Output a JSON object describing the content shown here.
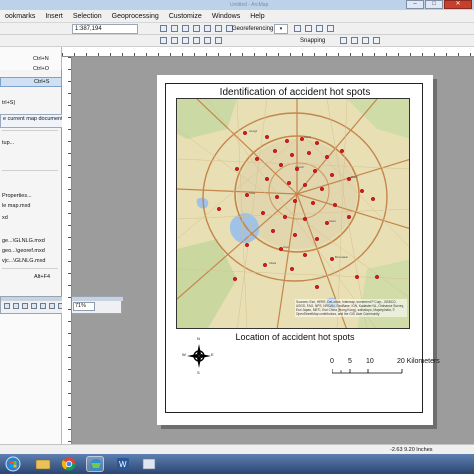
{
  "window": {
    "title": "Untitled - ArcMap"
  },
  "menubar": {
    "items": [
      {
        "label": "ookmarks",
        "active": false
      },
      {
        "label": "Insert",
        "active": false
      },
      {
        "label": "Selection",
        "active": false
      },
      {
        "label": "Geoprocessing",
        "active": false
      },
      {
        "label": "Customize",
        "active": false
      },
      {
        "label": "Windows",
        "active": false
      },
      {
        "label": "Help",
        "active": false
      }
    ]
  },
  "toolbar": {
    "scale_value": "1:387,194",
    "georeferencing_label": "Georeferencing",
    "snapping_label": "Snapping"
  },
  "file_menu": {
    "shortcuts": {
      "new": "Ctrl+N",
      "open": "Ctrl+O",
      "save": "Ctrl+S",
      "exit": "Alt+F4"
    },
    "tooltip_line1": "trl+S)",
    "tooltip_line2": "e current map document.",
    "items": {
      "setup": "tup...",
      "properties": "Properties...",
      "recent1": "le map.mxd",
      "recent2": "xd",
      "recent3": "ge...\\GLNLG.mxd",
      "recent4": "geo...\\georef.mxd",
      "recent5": "vjc...\\GLNLG.mxd"
    }
  },
  "layout_toolbar": {
    "zoom": "71%"
  },
  "layout": {
    "title": "Identification of accident hot spots",
    "subtitle": "Location of accident hot spots",
    "attribution": "Sources: Esri, HERE, DeLorme, Intermap, increment P Corp., GEBCO, USGS, FAO, NPS, NRCAN, GeoBase, IGN, Kadaster NL, Ordnance Survey, Esri Japan, METI, Esri China (Hong Kong), swisstopo, MapmyIndia, © OpenStreetMap contributors, and the GIS User Community",
    "north": {
      "n": "N",
      "s": "S",
      "e": "E",
      "w": "W"
    },
    "scale_labels": {
      "zero": "0",
      "five": "5",
      "ten": "10",
      "twenty": "20 Kilometers"
    }
  },
  "statusbar": {
    "coords": "-2.63  9.20 Inches"
  },
  "colors": {
    "hotspot": "#e0151b",
    "road_major": "#c4864a",
    "water": "#9fc2e6"
  }
}
